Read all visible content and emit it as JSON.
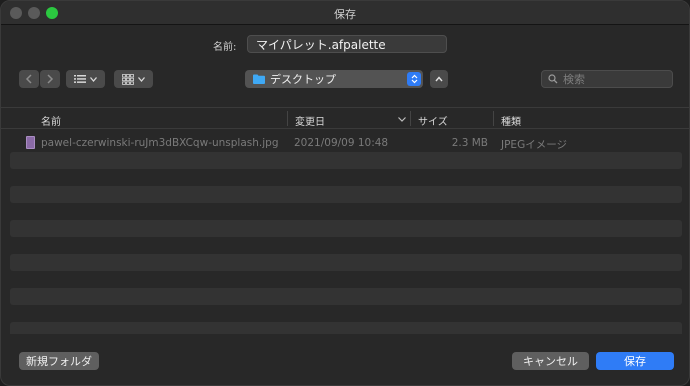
{
  "window": {
    "title": "保存"
  },
  "name_field": {
    "label": "名前:",
    "value": "マイパレット.afpalette"
  },
  "toolbar": {
    "location": "デスクトップ",
    "search_placeholder": "検索"
  },
  "columns": [
    "名前",
    "変更日",
    "サイズ",
    "種類"
  ],
  "files": [
    {
      "name": "pawel-czerwinski-ruJm3dBXCqw-unsplash.jpg",
      "modified": "2021/09/09 10:48",
      "size": "2.3 MB",
      "kind": "JPEGイメージ"
    }
  ],
  "buttons": {
    "new_folder": "新規フォルダ",
    "cancel": "キャンセル",
    "save": "保存"
  },
  "colors": {
    "accent": "#2f7cf6",
    "background": "#282828",
    "row_stripe": "#333333"
  }
}
